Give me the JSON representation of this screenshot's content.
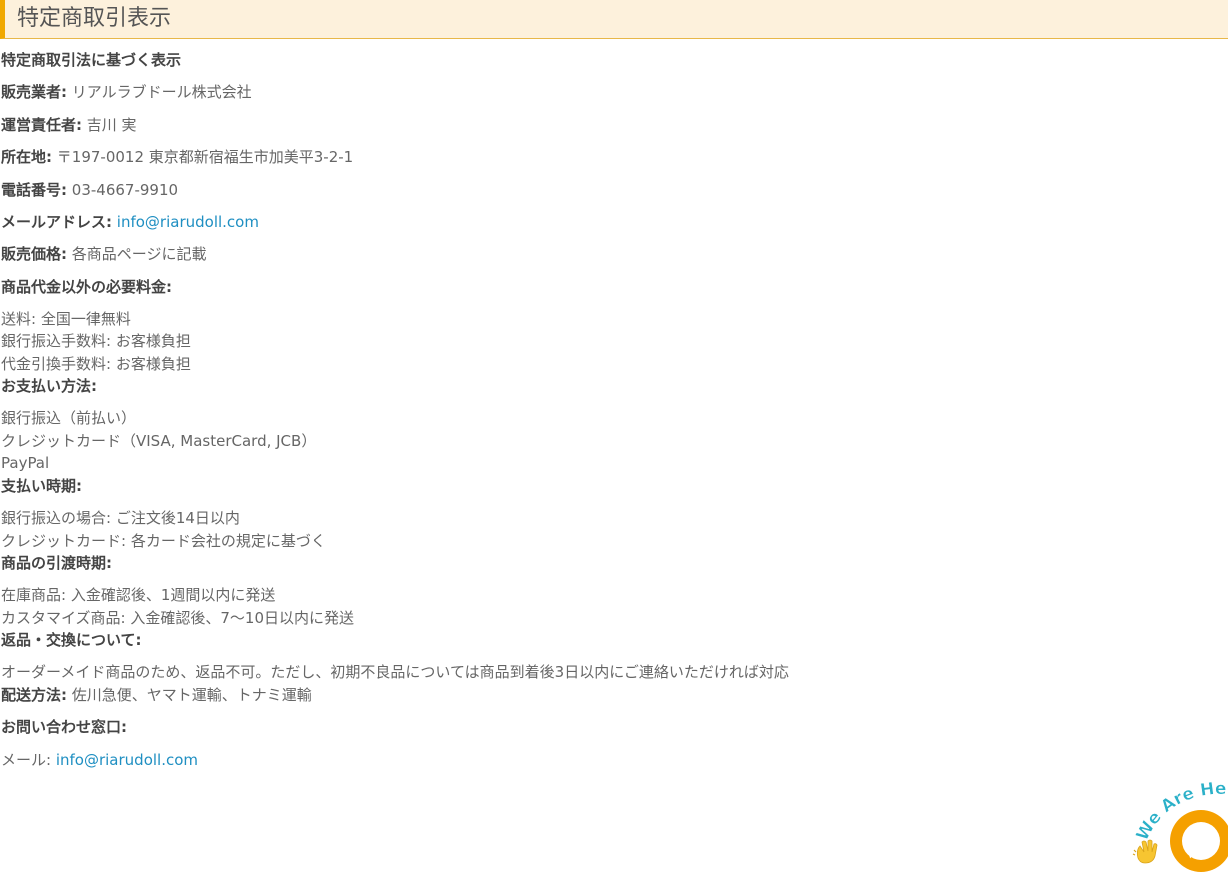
{
  "header": {
    "title": "特定商取引表示"
  },
  "content": {
    "heading": "特定商取引法に基づく表示",
    "seller": {
      "label": "販売業者:",
      "value": "リアルラブドール株式会社"
    },
    "manager": {
      "label": "運営責任者:",
      "value": "吉川 実"
    },
    "address": {
      "label": "所在地:",
      "value": "〒197-0012 東京都新宿福生市加美平3-2-1"
    },
    "phone": {
      "label": "電話番号:",
      "value": "03-4667-9910"
    },
    "email": {
      "label": "メールアドレス:",
      "value": "info@riarudoll.com"
    },
    "price": {
      "label": "販売価格:",
      "value": "各商品ページに記載"
    },
    "extra_fees": {
      "label": "商品代金以外の必要料金:",
      "items": [
        "送料: 全国一律無料",
        "銀行振込手数料: お客様負担",
        "代金引換手数料: お客様負担"
      ]
    },
    "payment_methods": {
      "label": "お支払い方法:",
      "items": [
        "銀行振込（前払い）",
        "クレジットカード（VISA, MasterCard, JCB）",
        "PayPal"
      ]
    },
    "payment_timing": {
      "label": "支払い時期:",
      "items": [
        "銀行振込の場合: ご注文後14日以内",
        "クレジットカード: 各カード会社の規定に基づく"
      ]
    },
    "delivery_timing": {
      "label": "商品の引渡時期:",
      "items": [
        "在庫商品: 入金確認後、1週間以内に発送",
        "カスタマイズ商品: 入金確認後、7〜10日以内に発送"
      ]
    },
    "returns": {
      "label": "返品・交換について:",
      "items": [
        "オーダーメイド商品のため、返品不可。ただし、初期不良品については商品到着後3日以内にご連絡いただければ対応"
      ]
    },
    "shipping": {
      "label": "配送方法:",
      "value": "佐川急便、ヤマト運輸、トナミ運輸"
    },
    "contact": {
      "label": "お問い合わせ窓口:",
      "prefix": "メール:",
      "email": "info@riarudoll.com"
    }
  },
  "chat_widget": {
    "text": "We Are Here!",
    "icon": "chat-bubble-icon",
    "hand_icon": "waving-hand-icon",
    "colors": {
      "bubble": "#f5a000",
      "text": "#2ab0c8",
      "hand": "#f7c531"
    }
  },
  "colors": {
    "header_bg": "#fdf1dc",
    "header_accent": "#f0a800",
    "link": "#1f8fc2",
    "text": "#555555"
  }
}
